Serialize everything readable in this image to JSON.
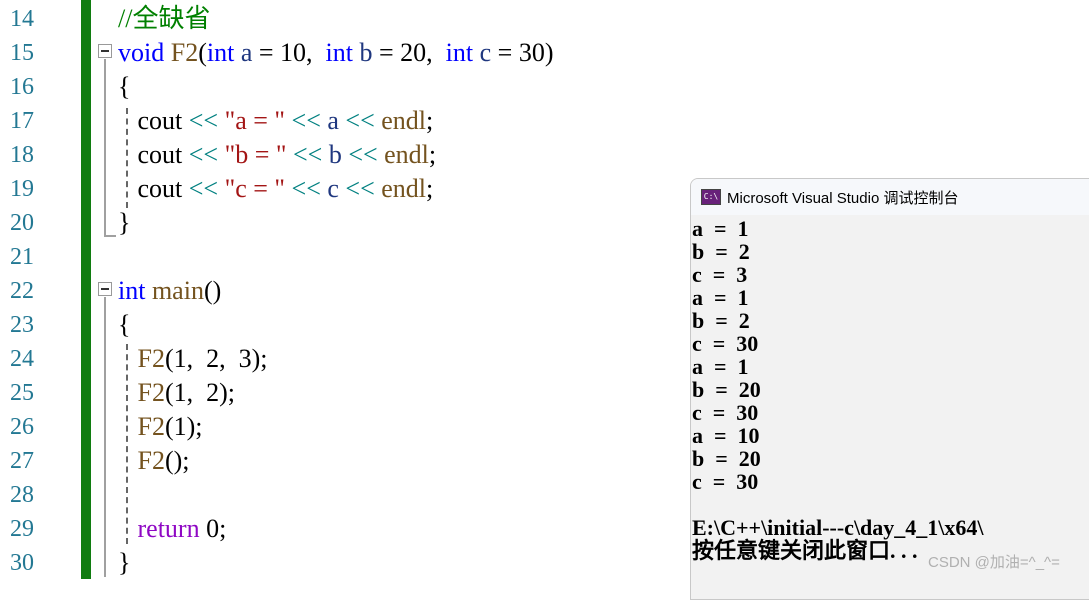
{
  "editor": {
    "line_numbers": [
      "14",
      "15",
      "16",
      "17",
      "18",
      "19",
      "20",
      "21",
      "22",
      "23",
      "24",
      "25",
      "26",
      "27",
      "28",
      "29",
      "30"
    ],
    "lines": [
      {
        "tokens": [
          {
            "t": "//全缺省",
            "c": "cmt"
          }
        ]
      },
      {
        "tokens": [
          {
            "t": "void",
            "c": "kw"
          },
          {
            "t": " "
          },
          {
            "t": "F2",
            "c": "fn"
          },
          {
            "t": "("
          },
          {
            "t": "int",
            "c": "kw"
          },
          {
            "t": " "
          },
          {
            "t": "a",
            "c": "var"
          },
          {
            "t": " = "
          },
          {
            "t": "10",
            "c": "num"
          },
          {
            "t": ",  "
          },
          {
            "t": "int",
            "c": "kw"
          },
          {
            "t": " "
          },
          {
            "t": "b",
            "c": "var"
          },
          {
            "t": " = "
          },
          {
            "t": "20",
            "c": "num"
          },
          {
            "t": ",  "
          },
          {
            "t": "int",
            "c": "kw"
          },
          {
            "t": " "
          },
          {
            "t": "c",
            "c": "var"
          },
          {
            "t": " = "
          },
          {
            "t": "30",
            "c": "num"
          },
          {
            "t": ")"
          }
        ]
      },
      {
        "tokens": [
          {
            "t": "{"
          }
        ]
      },
      {
        "tokens": [
          {
            "t": "   cout ",
            "c": ""
          },
          {
            "t": "<<",
            "c": "op"
          },
          {
            "t": " "
          },
          {
            "t": "\"a = \"",
            "c": "str"
          },
          {
            "t": " "
          },
          {
            "t": "<<",
            "c": "op"
          },
          {
            "t": " "
          },
          {
            "t": "a",
            "c": "var"
          },
          {
            "t": " "
          },
          {
            "t": "<<",
            "c": "op"
          },
          {
            "t": " "
          },
          {
            "t": "endl",
            "c": "fn"
          },
          {
            "t": ";"
          }
        ]
      },
      {
        "tokens": [
          {
            "t": "   cout ",
            "c": ""
          },
          {
            "t": "<<",
            "c": "op"
          },
          {
            "t": " "
          },
          {
            "t": "\"b = \"",
            "c": "str"
          },
          {
            "t": " "
          },
          {
            "t": "<<",
            "c": "op"
          },
          {
            "t": " "
          },
          {
            "t": "b",
            "c": "var"
          },
          {
            "t": " "
          },
          {
            "t": "<<",
            "c": "op"
          },
          {
            "t": " "
          },
          {
            "t": "endl",
            "c": "fn"
          },
          {
            "t": ";"
          }
        ]
      },
      {
        "tokens": [
          {
            "t": "   cout ",
            "c": ""
          },
          {
            "t": "<<",
            "c": "op"
          },
          {
            "t": " "
          },
          {
            "t": "\"c = \"",
            "c": "str"
          },
          {
            "t": " "
          },
          {
            "t": "<<",
            "c": "op"
          },
          {
            "t": " "
          },
          {
            "t": "c",
            "c": "var"
          },
          {
            "t": " "
          },
          {
            "t": "<<",
            "c": "op"
          },
          {
            "t": " "
          },
          {
            "t": "endl",
            "c": "fn"
          },
          {
            "t": ";"
          }
        ]
      },
      {
        "tokens": [
          {
            "t": "}"
          }
        ]
      },
      {
        "tokens": []
      },
      {
        "tokens": [
          {
            "t": "int",
            "c": "kw"
          },
          {
            "t": " "
          },
          {
            "t": "main",
            "c": "fn"
          },
          {
            "t": "()"
          }
        ]
      },
      {
        "tokens": [
          {
            "t": "{"
          }
        ]
      },
      {
        "tokens": [
          {
            "t": "   "
          },
          {
            "t": "F2",
            "c": "fn"
          },
          {
            "t": "(1,  2,  3);"
          }
        ]
      },
      {
        "tokens": [
          {
            "t": "   "
          },
          {
            "t": "F2",
            "c": "fn"
          },
          {
            "t": "(1,  2);"
          }
        ]
      },
      {
        "tokens": [
          {
            "t": "   "
          },
          {
            "t": "F2",
            "c": "fn"
          },
          {
            "t": "(1);"
          }
        ]
      },
      {
        "tokens": [
          {
            "t": "   "
          },
          {
            "t": "F2",
            "c": "fn"
          },
          {
            "t": "();"
          }
        ]
      },
      {
        "tokens": []
      },
      {
        "tokens": [
          {
            "t": "   "
          },
          {
            "t": "return",
            "c": "ret"
          },
          {
            "t": " 0;"
          }
        ]
      },
      {
        "tokens": [
          {
            "t": "}"
          }
        ]
      }
    ]
  },
  "console": {
    "title": "Microsoft Visual Studio 调试控制台",
    "icon": "vs-console-icon",
    "icon_text": "C:\\",
    "output": [
      "a  =  1",
      "b  =  2",
      "c  =  3",
      "a  =  1",
      "b  =  2",
      "c  =  30",
      "a  =  1",
      "b  =  20",
      "c  =  30",
      "a  =  10",
      "b  =  20",
      "c  =  30",
      "",
      "E:\\C++\\initial---c\\day_4_1\\x64\\",
      "按任意键关闭此窗口. . ."
    ]
  },
  "watermark": "CSDN @加油=^_^="
}
